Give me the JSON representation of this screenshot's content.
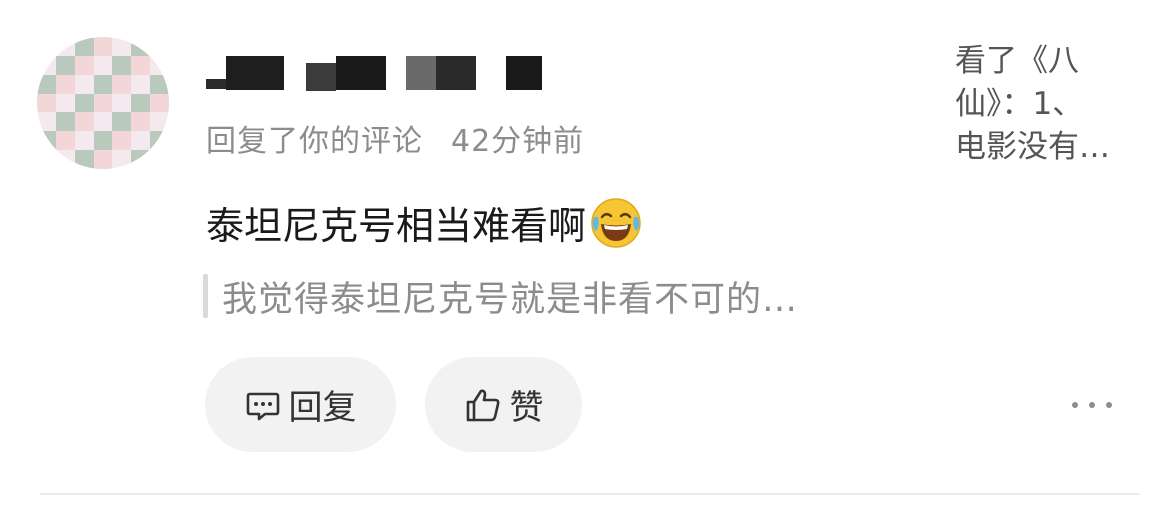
{
  "notification": {
    "action_text": "回复了你的评论",
    "time": "42分钟前",
    "comment_text": "泰坦尼克号相当难看啊",
    "emoji": "face-with-tears-of-joy",
    "quoted_text": "我觉得泰坦尼克号就是非看不可的…",
    "source_lines": [
      "看了《八",
      "仙》：1、",
      "电影没有…"
    ]
  },
  "actions": {
    "reply_label": "回复",
    "like_label": "赞"
  },
  "icons": {
    "reply": "comment-bubble-icon",
    "like": "thumbs-up-icon",
    "more": "more-dots-icon"
  },
  "colors": {
    "primary_text": "#1a1a1a",
    "secondary_text": "#8c8c8c",
    "button_bg": "#f2f2f2"
  }
}
